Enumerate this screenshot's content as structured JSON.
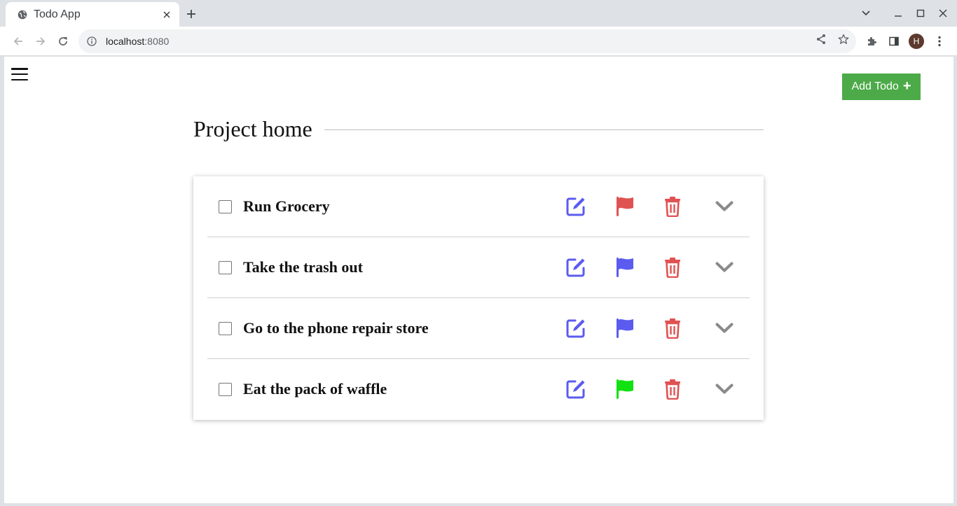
{
  "browser": {
    "tab_title": "Todo App",
    "url_host": "localhost",
    "url_port": ":8080",
    "profile_initial": "H"
  },
  "page": {
    "add_button_label": "Add Todo",
    "add_button_icon": "+",
    "project_title": "Project home"
  },
  "todos": [
    {
      "title": "Run Grocery",
      "flag_color": "#e05252",
      "checked": false
    },
    {
      "title": "Take the trash out",
      "flag_color": "#5b5bf0",
      "checked": false
    },
    {
      "title": "Go to the phone repair store",
      "flag_color": "#5b5bf0",
      "checked": false
    },
    {
      "title": "Eat the pack of waffle",
      "flag_color": "#11e011",
      "checked": false
    }
  ],
  "colors": {
    "edit": "#5b5bf0",
    "delete": "#e05252",
    "expand": "#8a8a8a",
    "add_button": "#4caa48"
  }
}
